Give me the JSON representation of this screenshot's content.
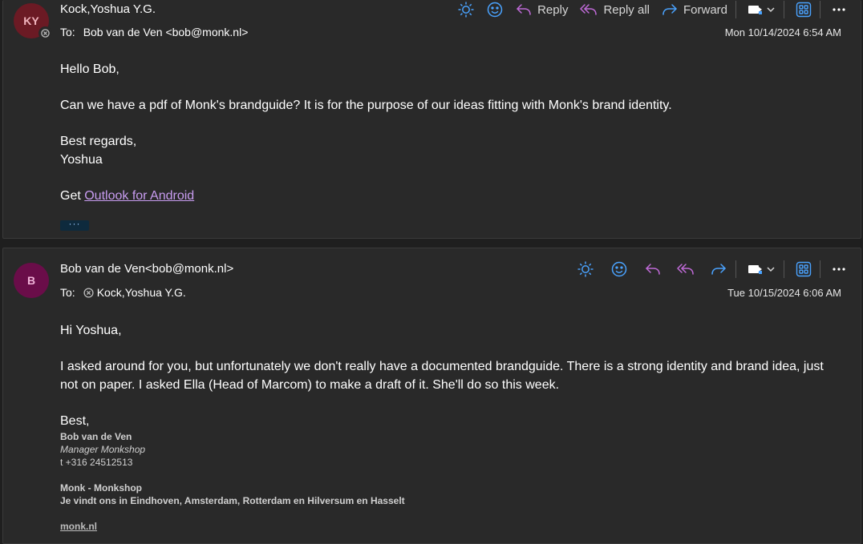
{
  "messages": [
    {
      "avatar_initials": "KY",
      "avatar_color": "#6b1a24",
      "sender": "Kock,Yoshua Y.G.",
      "to_label": "To:",
      "to": "Bob van de Ven <bob@monk.nl>",
      "date": "Mon 10/14/2024 6:54 AM",
      "actions": {
        "reply": "Reply",
        "reply_all": "Reply all",
        "forward": "Forward"
      },
      "body": {
        "greeting": "Hello Bob,",
        "paragraph": "Can we have a pdf of Monk's brandguide? It is for the purpose of our ideas fitting with Monk's brand identity.",
        "closing": "Best regards,",
        "name": "Yoshua",
        "get_prefix": "Get ",
        "get_link": "Outlook for Android",
        "more": "···"
      }
    },
    {
      "avatar_initials": "B",
      "avatar_color": "#6a0d49",
      "sender": "Bob van de Ven<bob@monk.nl>",
      "to_label": "To:",
      "to": "Kock,Yoshua Y.G.",
      "date": "Tue 10/15/2024 6:06 AM",
      "body": {
        "greeting": "Hi Yoshua,",
        "paragraph": "I asked around for you, but unfortunately we don't really have a documented brandguide. There is a strong identity and brand idea, just not on paper. I asked Ella (Head of Marcom) to make a draft of it. She'll do so this week.",
        "closing": "Best,",
        "sig_name": "Bob van de Ven",
        "sig_title": "Manager Monkshop",
        "sig_phone": "t +316 24512513",
        "sig_company": "Monk - Monkshop",
        "sig_locations": "Je vindt ons in Eindhoven, Amsterdam, Rotterdam en Hilversum en Hasselt",
        "sig_link": "monk.nl"
      }
    }
  ],
  "colors": {
    "accent": "#4aa3ff",
    "reply_icon": "#c06ad8",
    "link": "#c89cf0"
  },
  "icons": [
    "sun-icon",
    "emoji-icon",
    "reply-icon",
    "reply-all-icon",
    "forward-icon",
    "tag-icon",
    "chevron-down-icon",
    "apps-icon",
    "more-icon",
    "blocked-icon"
  ]
}
